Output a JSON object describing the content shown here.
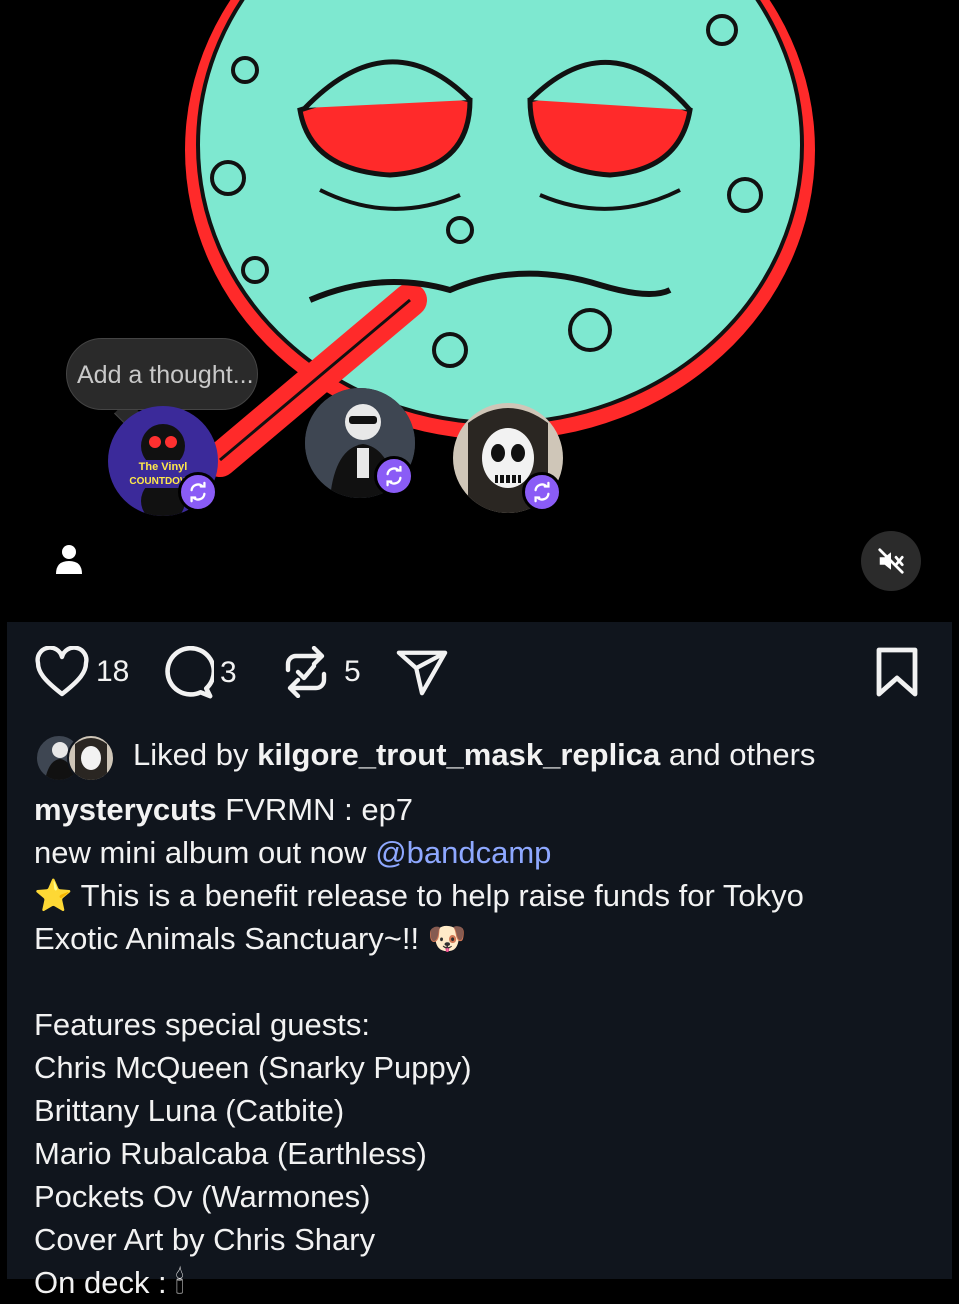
{
  "media": {
    "thought_placeholder": "Add a thought...",
    "avatars": [
      {
        "name": "the-vinyl-countdown",
        "label_line1": "The Vinyl",
        "label_line2": "COUNTDOWN"
      },
      {
        "name": "person-with-sunglasses"
      },
      {
        "name": "misfits-skull"
      }
    ],
    "icons": {
      "person": "person-icon",
      "mute": "speaker-muted-icon",
      "repost": "repost-icon"
    }
  },
  "actions": {
    "like_count": "18",
    "comment_count": "3",
    "repost_count": "5",
    "icons": [
      "heart-icon",
      "comment-icon",
      "repost-icon",
      "send-icon",
      "bookmark-icon"
    ]
  },
  "liked_by": {
    "prefix": "Liked by",
    "user": "kilgore_trout_mask_replica",
    "suffix": "and others"
  },
  "caption": {
    "username": "mysterycuts",
    "line1_rest": "FVRMN : ep7",
    "line2_text": "new mini album out now",
    "line2_mention": "@bandcamp",
    "line3": "⭐ This is a benefit release to help raise funds for Tokyo",
    "line4": "Exotic Animals Sanctuary~!! 🐶",
    "line5": "Features special guests:",
    "line6": "Chris McQueen (Snarky Puppy)",
    "line7": "Brittany Luna (Catbite)",
    "line8": "Mario Rubalcaba (Earthless)",
    "line9": "Pockets Ov (Warmones)",
    "line10": "Cover Art by Chris Shary",
    "line11": "On deck : 🕯"
  },
  "colors": {
    "accent_purple": "#8a5cf6",
    "mention": "#8ea8ff",
    "art_face": "#7ee8d0",
    "art_red": "#ff2a2a",
    "post_bg": "#10151d"
  }
}
